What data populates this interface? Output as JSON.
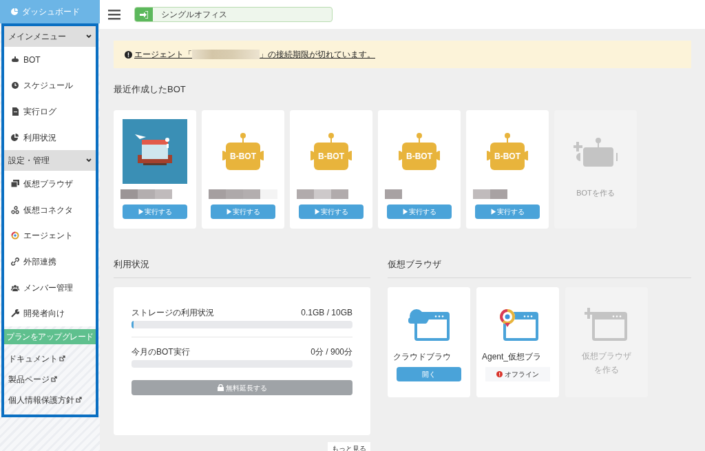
{
  "sidebar": {
    "dashboard": "ダッシュボード",
    "groups": [
      {
        "title": "メインメニュー",
        "expanded": true,
        "items": [
          {
            "label": "BOT"
          },
          {
            "label": "スケジュール"
          },
          {
            "label": "実行ログ"
          },
          {
            "label": "利用状況"
          }
        ]
      },
      {
        "title": "設定・管理",
        "expanded": true,
        "items": [
          {
            "label": "仮想ブラウザ"
          },
          {
            "label": "仮想コネクタ"
          },
          {
            "label": "エージェント"
          },
          {
            "label": "外部連携"
          },
          {
            "label": "メンバー管理"
          },
          {
            "label": "開発者向け"
          }
        ]
      }
    ],
    "upgrade_button": "プランをアップグレード",
    "links": [
      "ドキュメント",
      "製品ページ",
      "個人情報保護方針"
    ]
  },
  "header": {
    "office": "シングルオフィス"
  },
  "alert": {
    "before": "エージェント「",
    "after": "」の接続期限が切れています。"
  },
  "recent_bots": {
    "title": "最近作成したBOT",
    "bots": [
      {
        "kind": "picture",
        "run": "▶実行する"
      },
      {
        "kind": "bbot",
        "logo": "B-BOT",
        "run": "▶実行する"
      },
      {
        "kind": "bbot",
        "logo": "B-BOT",
        "run": "▶実行する"
      },
      {
        "kind": "bbot",
        "logo": "B-BOT",
        "run": "▶実行する"
      },
      {
        "kind": "bbot",
        "logo": "B-BOT",
        "run": "▶実行する"
      }
    ],
    "create": "BOTを作る"
  },
  "usage": {
    "title": "利用状況",
    "meters": [
      {
        "label": "ストレージの利用状況",
        "reading": "0.1GB / 10GB",
        "level": 0.01
      },
      {
        "label": "今月のBOT実行",
        "reading": "0分 / 900分",
        "level": 0
      }
    ],
    "extend_button": "無料延長する",
    "more": "もっと見る"
  },
  "virtual_browsers": {
    "title": "仮想ブラウザ",
    "browsers": [
      {
        "kind": "cloud",
        "name": "クラウドブラウ",
        "action": "開く"
      },
      {
        "kind": "agent",
        "name": "Agent_仮想ブラ",
        "status": "オフライン"
      }
    ],
    "create": "仮想ブラウザを作る"
  }
}
